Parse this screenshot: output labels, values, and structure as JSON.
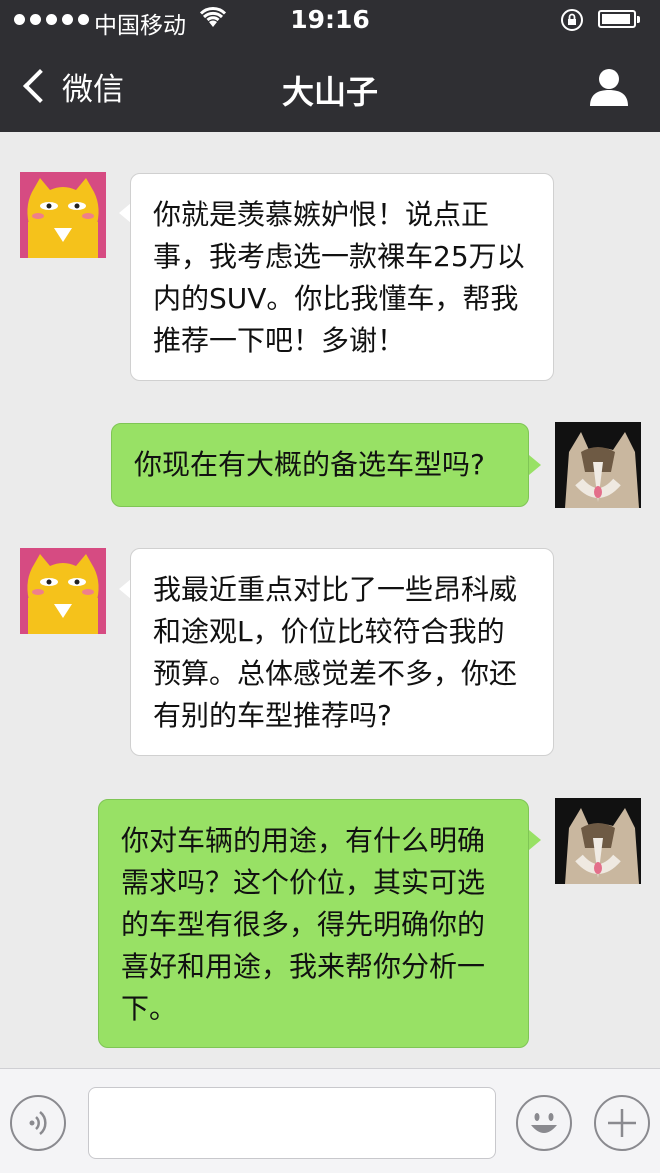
{
  "status_bar": {
    "carrier": "中国移动",
    "time": "19:16",
    "signal_icon": "signal-dots-icon",
    "wifi_icon": "wifi-icon",
    "lock_icon": "rotation-lock-icon",
    "battery_icon": "battery-icon"
  },
  "nav": {
    "back_label": "微信",
    "title": "大山子",
    "profile_icon": "person-icon"
  },
  "messages": [
    {
      "side": "left",
      "avatar": "cartoon-cat-avatar",
      "text": "你就是羡慕嫉妒恨！说点正事，我考虑选一款裸车25万以内的SUV。你比我懂车，帮我推荐一下吧！多谢！"
    },
    {
      "side": "right",
      "avatar": "cat-photo-avatar",
      "text": "你现在有大概的备选车型吗?"
    },
    {
      "side": "left",
      "avatar": "cartoon-cat-avatar",
      "text": "我最近重点对比了一些昂科威和途观L，价位比较符合我的预算。总体感觉差不多，你还有别的车型推荐吗?"
    },
    {
      "side": "right",
      "avatar": "cat-photo-avatar",
      "text": "你对车辆的用途，有什么明确需求吗？这个价位，其实可选的车型有很多，得先明确你的喜好和用途，我来帮你分析一下。"
    }
  ],
  "input_bar": {
    "voice_icon": "voice-icon",
    "text_value": "",
    "emoji_icon": "emoji-icon",
    "plus_icon": "plus-icon"
  },
  "colors": {
    "header_bg": "#2f2f33",
    "chat_bg": "#ebebeb",
    "bubble_left": "#ffffff",
    "bubble_right": "#98e165"
  }
}
